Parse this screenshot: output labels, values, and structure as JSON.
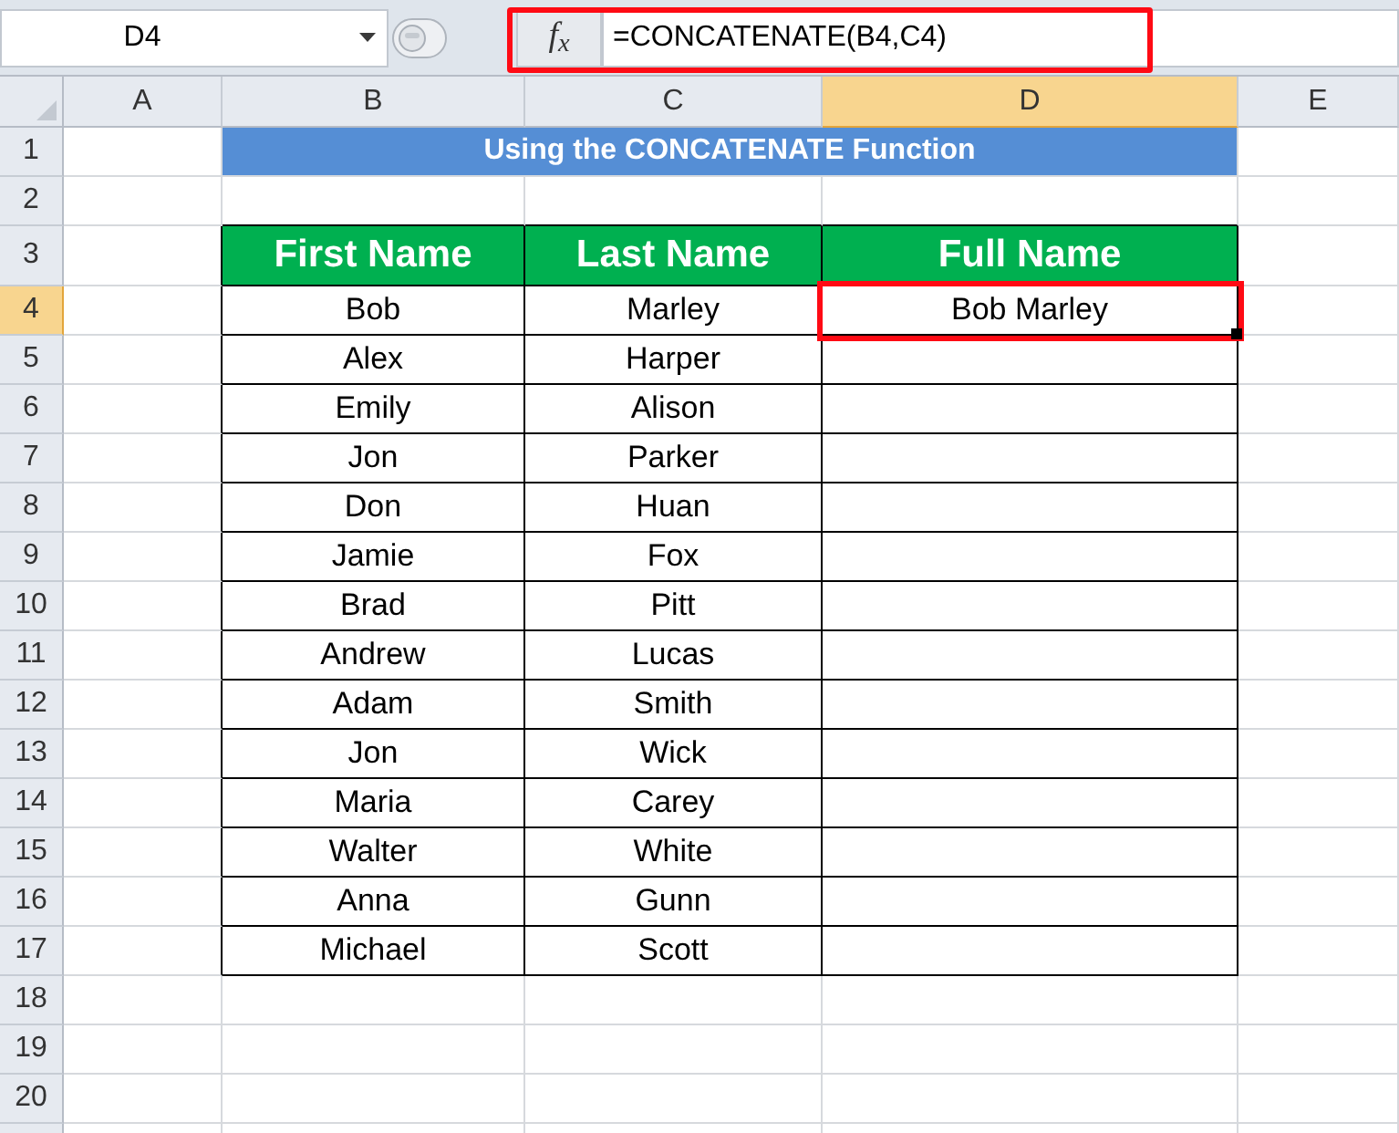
{
  "name_box": {
    "value": "D4"
  },
  "formula_bar": {
    "function_button": "f$_{x}$",
    "formula": "=CONCATENATE(B4,C4)",
    "highlighted": true
  },
  "column_headers": [
    {
      "label": "A",
      "selected": false
    },
    {
      "label": "B",
      "selected": false
    },
    {
      "label": "C",
      "selected": false
    },
    {
      "label": "D",
      "selected": true
    },
    {
      "label": "E",
      "selected": false
    }
  ],
  "row_headers": [
    {
      "label": "1",
      "selected": false
    },
    {
      "label": "2",
      "selected": false
    },
    {
      "label": "3",
      "selected": false
    },
    {
      "label": "4",
      "selected": true
    },
    {
      "label": "5",
      "selected": false
    },
    {
      "label": "6",
      "selected": false
    },
    {
      "label": "7",
      "selected": false
    },
    {
      "label": "8",
      "selected": false
    },
    {
      "label": "9",
      "selected": false
    },
    {
      "label": "10",
      "selected": false
    },
    {
      "label": "11",
      "selected": false
    },
    {
      "label": "12",
      "selected": false
    },
    {
      "label": "13",
      "selected": false
    },
    {
      "label": "14",
      "selected": false
    },
    {
      "label": "15",
      "selected": false
    },
    {
      "label": "16",
      "selected": false
    },
    {
      "label": "17",
      "selected": false
    },
    {
      "label": "18",
      "selected": false
    },
    {
      "label": "19",
      "selected": false
    },
    {
      "label": "20",
      "selected": false
    }
  ],
  "title": "Using the CONCATENATE Function",
  "table": {
    "columns": [
      "First Name",
      "Last Name",
      "Full Name"
    ],
    "rows": [
      {
        "first_name": "Bob",
        "last_name": "Marley",
        "full_name": "Bob Marley",
        "selected": true
      },
      {
        "first_name": "Alex",
        "last_name": "Harper",
        "selected": false
      },
      {
        "first_name": "Emily",
        "last_name": "Alison",
        "selected": false
      },
      {
        "first_name": "Jon",
        "last_name": "Parker",
        "selected": false
      },
      {
        "first_name": "Don",
        "last_name": "Huan",
        "selected": false
      },
      {
        "first_name": "Jamie",
        "last_name": "Fox",
        "selected": false
      },
      {
        "first_name": "Brad",
        "last_name": "Pitt",
        "selected": false
      },
      {
        "first_name": "Andrew",
        "last_name": "Lucas",
        "selected": false
      },
      {
        "first_name": "Adam",
        "last_name": "Smith",
        "selected": false
      },
      {
        "first_name": "Jon",
        "last_name": "Wick",
        "selected": false
      },
      {
        "first_name": "Maria",
        "last_name": "Carey",
        "selected": false
      },
      {
        "first_name": "Walter",
        "last_name": "White",
        "selected": false
      },
      {
        "first_name": "Anna",
        "last_name": "Gunn",
        "selected": false
      },
      {
        "first_name": "Michael",
        "last_name": "Scott",
        "selected": false
      }
    ]
  }
}
